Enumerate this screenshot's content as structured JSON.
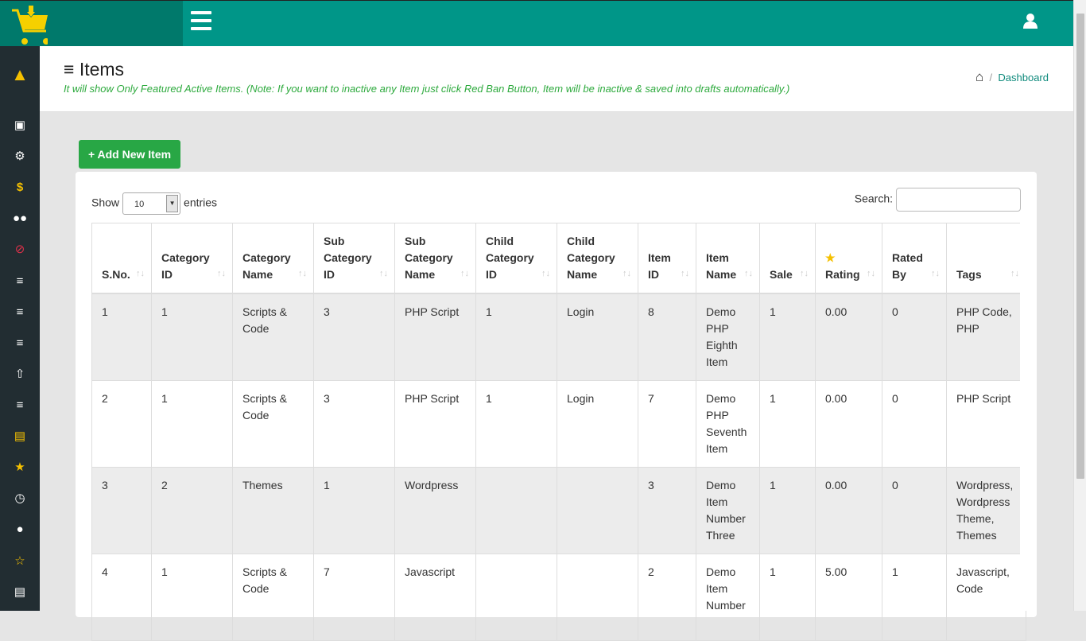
{
  "header": {
    "title": "Items",
    "note": "It will show Only Featured Active Items. (Note: If you want to inactive any Item just click Red Ban Button, Item will be inactive & saved into drafts automatically.)",
    "breadcrumb_sep": "/",
    "breadcrumb_link": "Dashboard"
  },
  "add_button": "+ Add New Item",
  "table_controls": {
    "show": "Show",
    "entries_value": "10",
    "entries": "entries",
    "search": "Search:"
  },
  "columns": [
    "S.No.",
    "Category ID",
    "Category Name",
    "Sub Category ID",
    "Sub Category Name",
    "Child Category ID",
    "Child Category Name",
    "Item ID",
    "Item Name",
    "Sale",
    "Rating",
    "Rated By",
    "Tags"
  ],
  "rows": [
    [
      "1",
      "1",
      "Scripts & Code",
      "3",
      "PHP Script",
      "1",
      "Login",
      "8",
      "Demo PHP Eighth Item",
      "1",
      "0.00",
      "0",
      "PHP Code, PHP"
    ],
    [
      "2",
      "1",
      "Scripts & Code",
      "3",
      "PHP Script",
      "1",
      "Login",
      "7",
      "Demo PHP Seventh Item",
      "1",
      "0.00",
      "0",
      "PHP Script"
    ],
    [
      "3",
      "2",
      "Themes",
      "1",
      "Wordpress",
      "",
      "",
      "3",
      "Demo Item Number Three",
      "1",
      "0.00",
      "0",
      "Wordpress, Wordpress Theme, Themes"
    ],
    [
      "4",
      "1",
      "Scripts & Code",
      "7",
      "Javascript",
      "",
      "",
      "2",
      "Demo Item Number",
      "1",
      "5.00",
      "1",
      "Javascript, Code"
    ]
  ],
  "sidebar": [
    "laptop-icon",
    "cog-icon",
    "dollar-icon",
    "users-icon",
    "ban-icon",
    "align-left-icon",
    "align-center-icon",
    "align-right-icon",
    "upload-icon",
    "list-ol-icon",
    "chart-icon",
    "star-icon",
    "clock-icon",
    "comment-icon",
    "star-half-icon",
    "file-icon"
  ],
  "colors": {
    "topbar": "#009688",
    "sidebar": "#222d32",
    "accent": "#28a745"
  }
}
